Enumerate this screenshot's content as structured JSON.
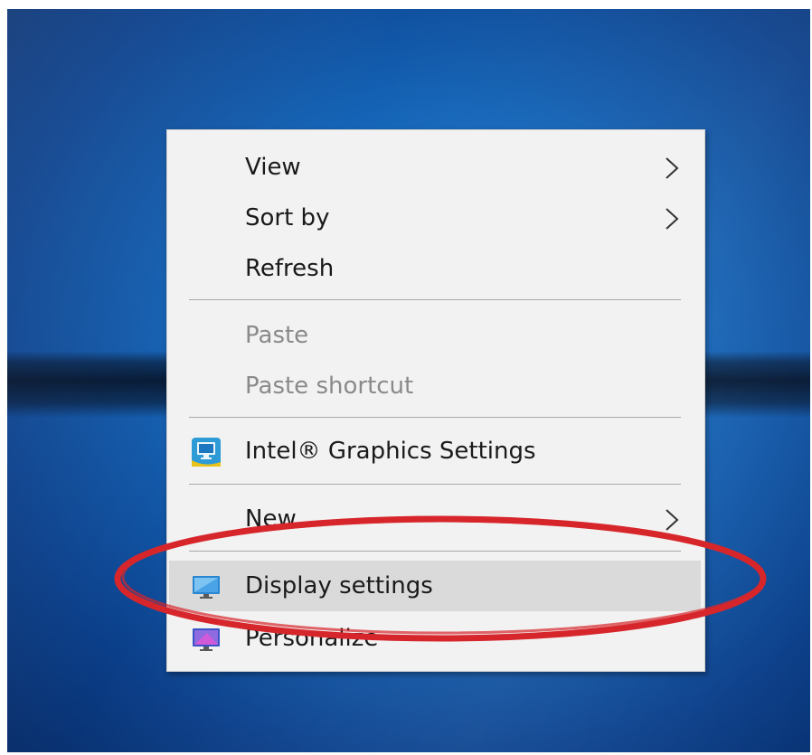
{
  "context_menu": {
    "items": [
      {
        "label": "View",
        "has_submenu": true,
        "enabled": true
      },
      {
        "label": "Sort by",
        "has_submenu": true,
        "enabled": true
      },
      {
        "label": "Refresh",
        "has_submenu": false,
        "enabled": true
      },
      {
        "label": "Paste",
        "has_submenu": false,
        "enabled": false
      },
      {
        "label": "Paste shortcut",
        "has_submenu": false,
        "enabled": false
      },
      {
        "label": "Intel® Graphics Settings",
        "has_submenu": false,
        "enabled": true,
        "icon": "intel-graphics-icon"
      },
      {
        "label": "New",
        "has_submenu": true,
        "enabled": true
      },
      {
        "label": "Display settings",
        "has_submenu": false,
        "enabled": true,
        "icon": "display-settings-icon",
        "highlighted": true
      },
      {
        "label": "Personalize",
        "has_submenu": false,
        "enabled": true,
        "icon": "personalize-icon"
      }
    ]
  },
  "annotation": {
    "shape": "ellipse",
    "color": "#d7262b",
    "target": "Display settings"
  },
  "colors": {
    "menu_background": "#f2f2f2",
    "highlight": "#dadada",
    "disabled_text": "#8a8a8a",
    "desktop_blue": "#1565b8"
  }
}
